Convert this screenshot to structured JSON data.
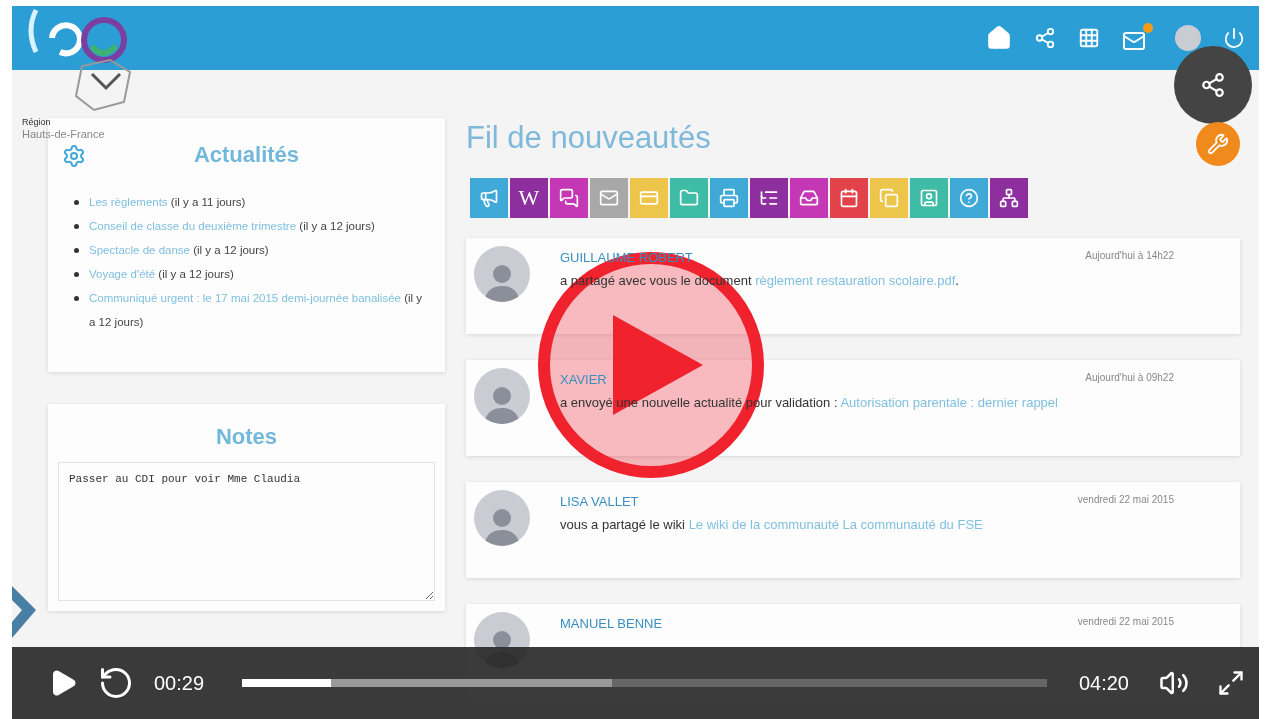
{
  "header": {
    "region_line1": "Région",
    "region_line2": "Hauts-de-France",
    "mail_badge": true
  },
  "news": {
    "title": "Actualités",
    "items": [
      {
        "link": "Les règlements",
        "meta": "(il y a 11 jours)"
      },
      {
        "link": "Conseil de classe du deuxième trimestre",
        "meta": "(il y a 12 jours)"
      },
      {
        "link": "Spectacle de danse",
        "meta": "(il y a 12 jours)"
      },
      {
        "link": "Voyage d'été",
        "meta": "(il y a 12 jours)"
      },
      {
        "link": "Communiqué urgent : le 17 mai 2015 demi-journée banalisée",
        "meta": "(il y a 12 jours)"
      }
    ]
  },
  "notes": {
    "title": "Notes",
    "value": "Passer au CDI pour voir Mme Claudia"
  },
  "feed": {
    "title": "Fil de nouveautés",
    "apps": [
      {
        "kind": "megaphone",
        "color": "#3fa9d8"
      },
      {
        "kind": "wiki",
        "color": "#8e2fa0",
        "glyph": "W"
      },
      {
        "kind": "chat",
        "color": "#c438b5"
      },
      {
        "kind": "mail",
        "color": "#a8a8a8"
      },
      {
        "kind": "card",
        "color": "#ecc54a"
      },
      {
        "kind": "folder",
        "color": "#3fbca5"
      },
      {
        "kind": "print",
        "color": "#3fa9d8"
      },
      {
        "kind": "tree",
        "color": "#8e2fa0"
      },
      {
        "kind": "inbox",
        "color": "#c438b5"
      },
      {
        "kind": "calendar",
        "color": "#e2434a"
      },
      {
        "kind": "copy",
        "color": "#ecc54a"
      },
      {
        "kind": "contact",
        "color": "#3fbca5"
      },
      {
        "kind": "help",
        "color": "#3fa9d8"
      },
      {
        "kind": "sitemap",
        "color": "#8e2fa0"
      }
    ],
    "items": [
      {
        "author": "GUILLAUME ROBERT",
        "time": "Aujourd'hui à 14h22",
        "text": "a partagé avec vous le document",
        "link": "règlement restauration scolaire.pdf",
        "tail": "."
      },
      {
        "author": "XAVIER",
        "time": "Aujourd'hui à 09h22",
        "text": "a envoyé une nouvelle actualité pour validation :",
        "link": "Autorisation parentale : dernier rappel"
      },
      {
        "author": "LISA VALLET",
        "time": "vendredi 22 mai 2015",
        "text": "vous a partagé le wiki",
        "link": "Le wiki de la communauté La communauté du FSE"
      },
      {
        "author": "MANUEL BENNE",
        "time": "vendredi 22 mai 2015"
      }
    ]
  },
  "player": {
    "paused": true,
    "current": "00:29",
    "duration": "04:20",
    "progress": {
      "level": 0.11
    },
    "buffer": {
      "level": 0.46
    }
  }
}
